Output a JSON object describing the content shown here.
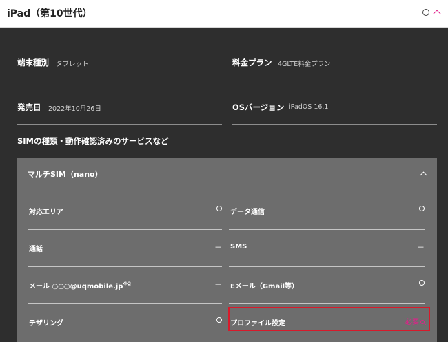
{
  "header": {
    "title": "iPad（第10世代）"
  },
  "specs": {
    "device_type": {
      "label": "端末種別",
      "value": "タブレット"
    },
    "plan": {
      "label": "料金プラン",
      "value": "4GLTE料金プラン"
    },
    "release_date": {
      "label": "発売日",
      "value": "2022年10月26日"
    },
    "os_version": {
      "label": "OSバージョン",
      "value": "iPadOS 16.1"
    }
  },
  "sim_section": {
    "title": "SIMの種類・動作確認済みのサービスなど",
    "accordion_label": "マルチSIM（nano）",
    "rows": {
      "area": {
        "label": "対応エリア",
        "value": "○"
      },
      "data": {
        "label": "データ通信",
        "value": "○"
      },
      "call": {
        "label": "通話",
        "value": "－"
      },
      "sms": {
        "label": "SMS",
        "value": "－"
      },
      "mail": {
        "label": "メール ○○○@uqmobile.jp",
        "note": "※2",
        "value": "－"
      },
      "email": {
        "label": "Eメール（Gmail等）",
        "value": "○"
      },
      "tethering": {
        "label": "テザリング",
        "value": "○"
      },
      "profile": {
        "label": "プロファイル設定",
        "value": "必要"
      }
    }
  },
  "colors": {
    "accent": "#e0218a",
    "highlight_border": "#d81a2b",
    "background": "#2e2e2e",
    "panel": "#6d6d6d"
  }
}
